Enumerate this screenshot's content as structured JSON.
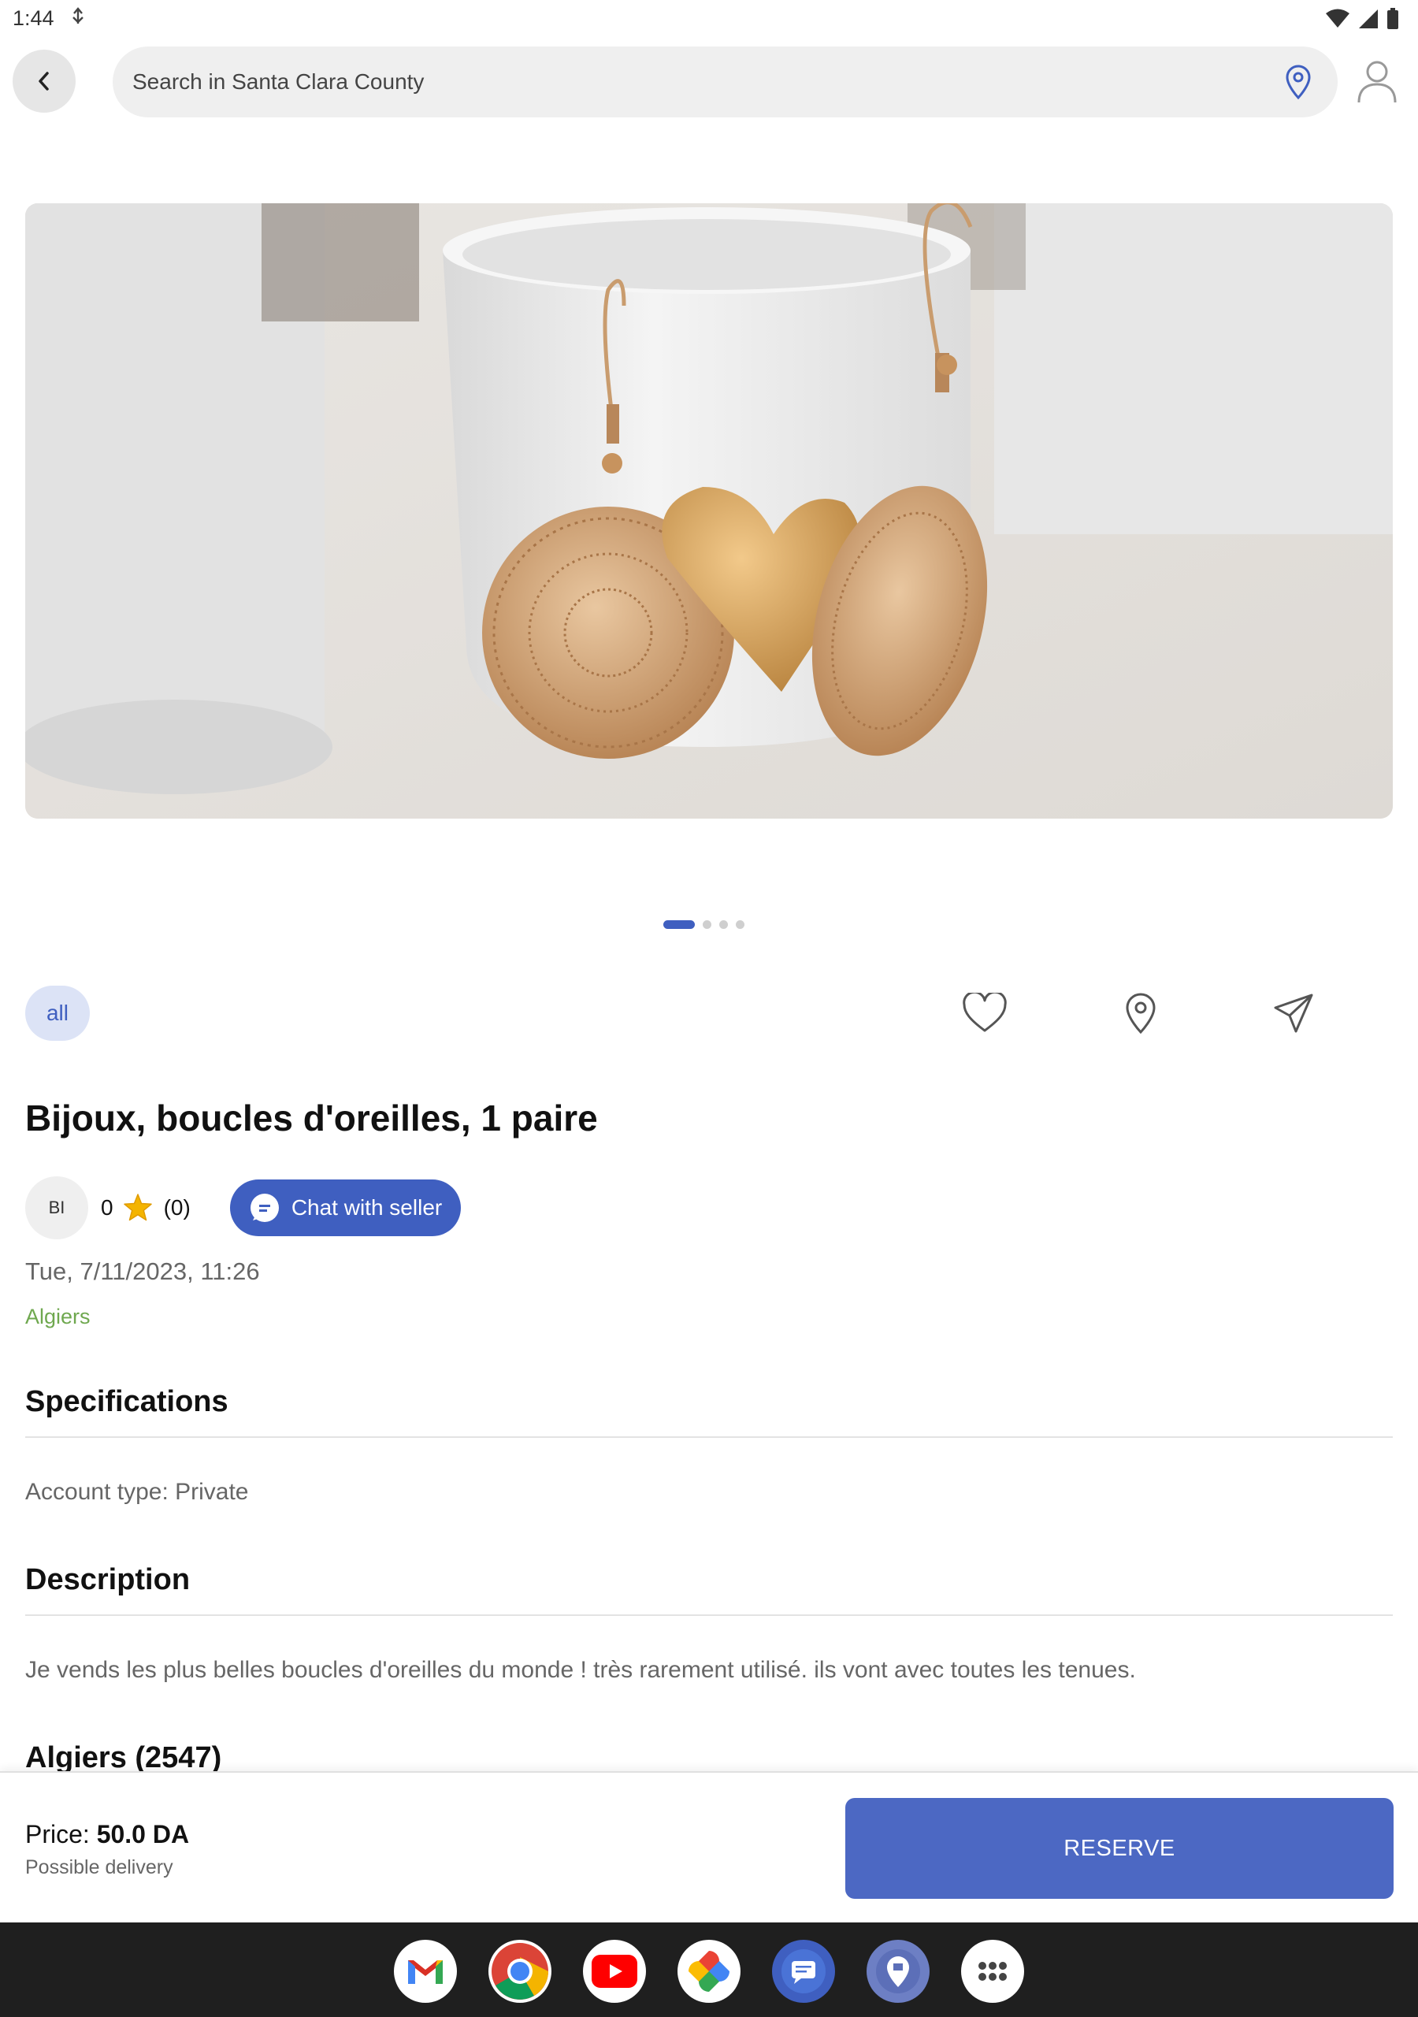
{
  "status_bar": {
    "time": "1:44"
  },
  "search": {
    "placeholder": "Search in Santa Clara County"
  },
  "carousel": {
    "image_count": 4,
    "active_index": 0
  },
  "category_chip": "all",
  "listing": {
    "title": "Bijoux, boucles d'oreilles, 1 paire",
    "seller_initials": "BI",
    "rating": "0",
    "rating_count": "(0)",
    "chat_label": "Chat with seller",
    "date": "Tue, 7/11/2023, 11:26",
    "location": "Algiers"
  },
  "specifications": {
    "title": "Specifications",
    "account_type": "Account type: Private"
  },
  "description": {
    "title": "Description",
    "text": "Je vends les plus belles boucles d'oreilles du monde !  très rarement utilisé.  ils vont avec toutes les tenues."
  },
  "map_section": {
    "title": "Algiers (2547)"
  },
  "price_bar": {
    "price_label": "Price:",
    "price_value": "50.0 DA",
    "delivery": "Possible delivery",
    "reserve_label": "RESERVE"
  },
  "dock": {
    "apps": [
      "gmail-icon",
      "chrome-icon",
      "youtube-icon",
      "photos-icon",
      "messages-icon",
      "maps-app-icon",
      "app-drawer-icon"
    ]
  },
  "colors": {
    "accent": "#3f5fc0",
    "reserve": "#4c68c3",
    "location_green": "#6fa84f",
    "star": "#f4b400"
  }
}
